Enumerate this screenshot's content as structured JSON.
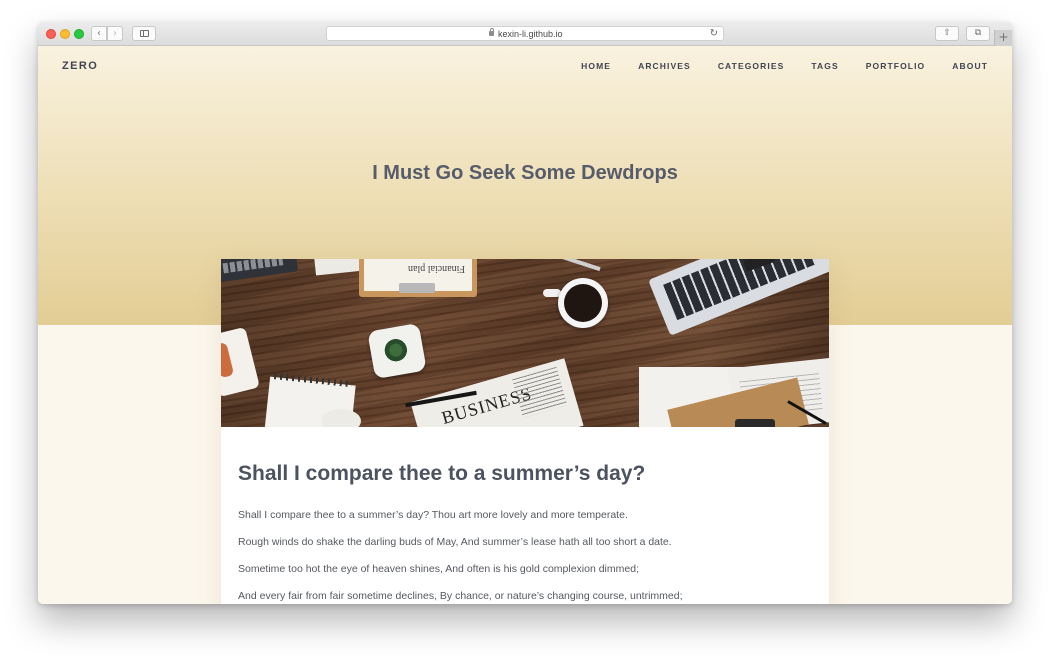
{
  "browser": {
    "url": "kexin-li.github.io",
    "back_glyph": "‹",
    "forward_glyph": "›",
    "reload_glyph": "↻",
    "share_glyph": "⇧",
    "tabs_glyph": "⧉",
    "newtab_glyph": "+"
  },
  "site": {
    "brand": "ZERO",
    "nav": [
      "HOME",
      "ARCHIVES",
      "CATEGORIES",
      "TAGS",
      "PORTFOLIO",
      "ABOUT"
    ]
  },
  "hero": {
    "title": "I Must Go Seek Some Dewdrops"
  },
  "photo": {
    "clipboard_text": "Financial plan",
    "newspaper_text": "BUSINESS"
  },
  "post": {
    "title": "Shall I compare thee to a summer’s day?",
    "paragraphs": [
      "Shall I compare thee to a summer’s day? Thou art more lovely and more temperate.",
      "Rough winds do shake the darling buds of May, And summer’s lease hath all too short a date.",
      "Sometime too hot the eye of heaven shines, And often is his gold complexion dimmed;",
      "And every fair from fair sometime declines, By chance, or nature’s changing course, untrimmed;"
    ]
  },
  "colors": {
    "hero_top": "#f9f2df",
    "hero_bottom": "#e3cd95",
    "page_bg": "#fcf7ec",
    "text_dark": "#3f4451",
    "heading": "#565c69"
  }
}
